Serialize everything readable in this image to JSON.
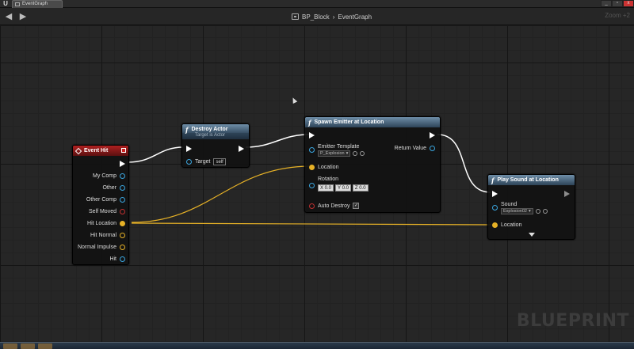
{
  "window": {
    "logo": "U",
    "tab_label": "EventGraph",
    "min_label": "_",
    "max_label": "▫",
    "close_label": "x"
  },
  "nav": {
    "breadcrumb_blueprint": "BP_Block",
    "breadcrumb_sep": "›",
    "breadcrumb_graph": "EventGraph",
    "zoom": "Zoom +2"
  },
  "watermark": "BLUEPRINT",
  "nodes": {
    "event_hit": {
      "title": "Event Hit",
      "pins": [
        "My Comp",
        "Other",
        "Other Comp",
        "Self Moved",
        "Hit Location",
        "Hit Normal",
        "Normal Impulse",
        "Hit"
      ]
    },
    "destroy_actor": {
      "title": "Destroy Actor",
      "subtitle": "Target is Actor",
      "target_label": "Target",
      "target_value": "self"
    },
    "spawn_emitter": {
      "title": "Spawn Emitter at Location",
      "emitter_label": "Emitter Template",
      "emitter_value": "P_Explosion",
      "return_label": "Return Value",
      "location_label": "Location",
      "rotation_label": "Rotation",
      "rotation": [
        "X 0.0",
        "Y 0.0",
        "Z 0.0"
      ],
      "auto_destroy_label": "Auto Destroy",
      "auto_destroy_checked": "✓"
    },
    "play_sound": {
      "title": "Play Sound at Location",
      "sound_label": "Sound",
      "sound_value": "Explosion02",
      "location_label": "Location"
    }
  },
  "colors": {
    "exec_wire": "#ffffff",
    "vector_wire": "#e6b126",
    "event_header": "#b02020",
    "function_header": "#6f8ea8"
  }
}
